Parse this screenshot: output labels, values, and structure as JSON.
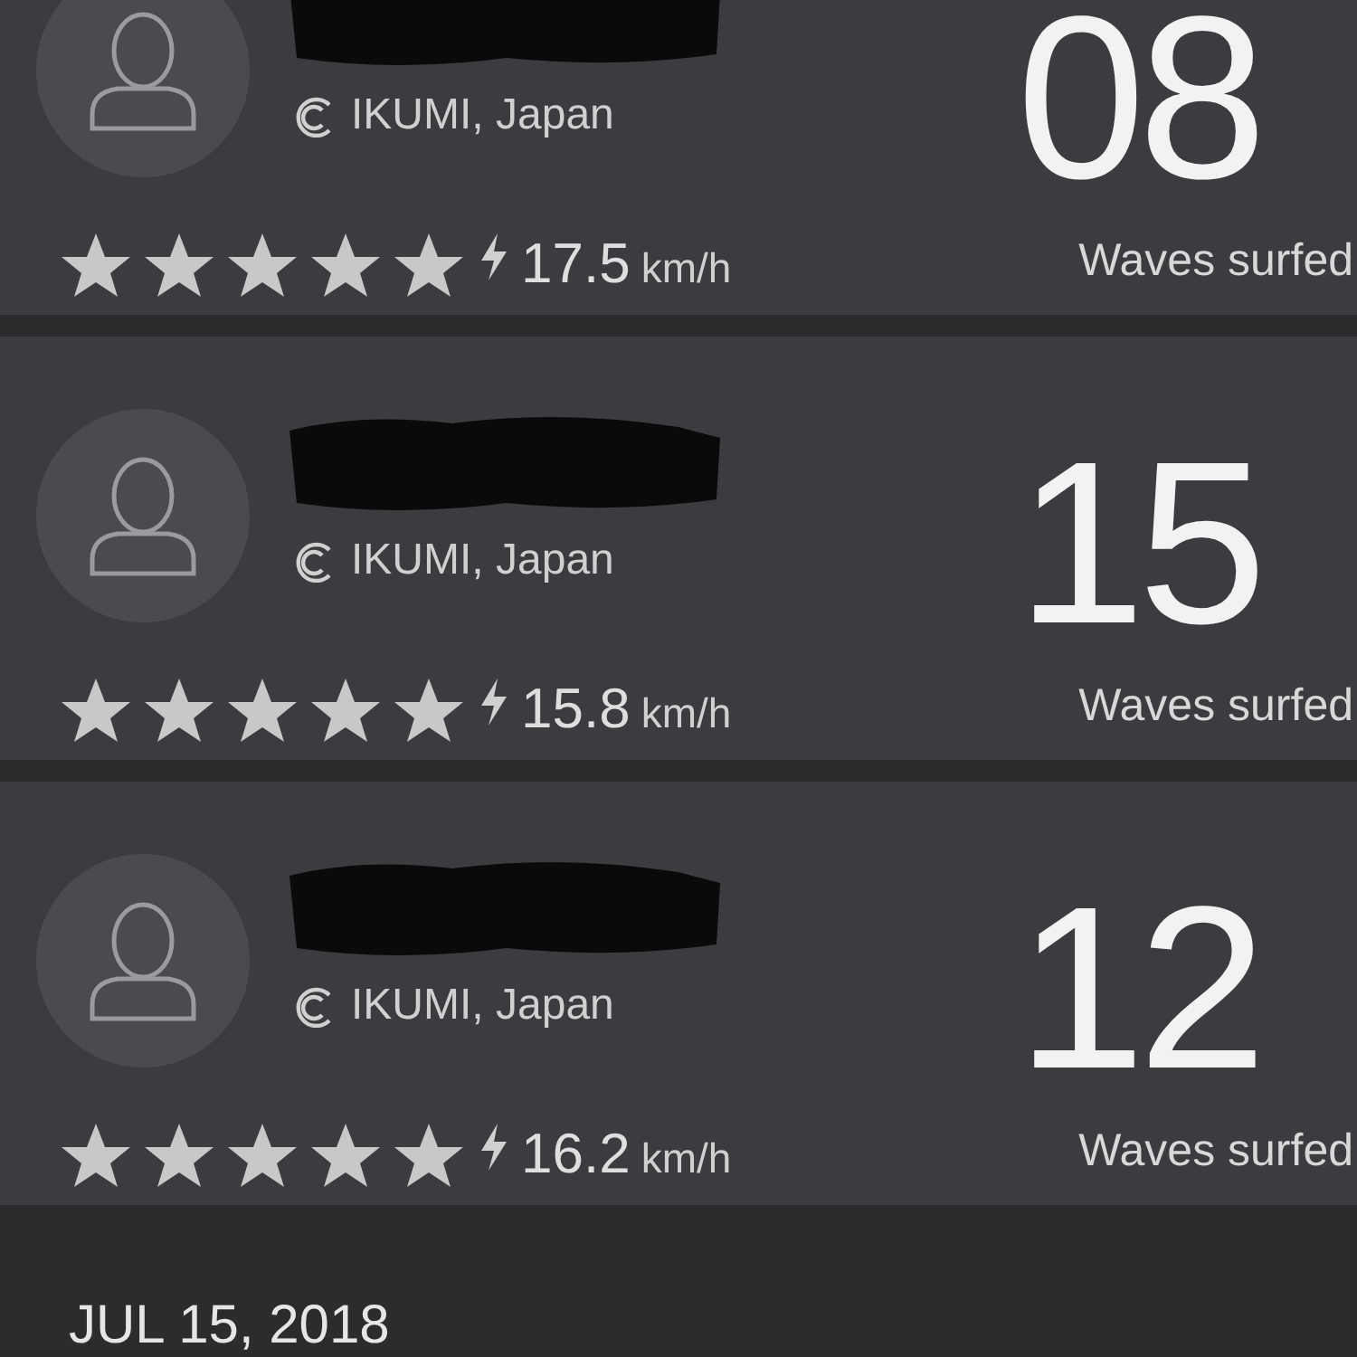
{
  "sessions": [
    {
      "location": "IKUMI, Japan",
      "stars": 5,
      "speed": "17.5",
      "speed_unit": "km/h",
      "waves": "08",
      "waves_label": "Waves surfed"
    },
    {
      "location": "IKUMI, Japan",
      "stars": 5,
      "speed": "15.8",
      "speed_unit": "km/h",
      "waves": "15",
      "waves_label": "Waves surfed"
    },
    {
      "location": "IKUMI, Japan",
      "stars": 5,
      "speed": "16.2",
      "speed_unit": "km/h",
      "waves": "12",
      "waves_label": "Waves surfed"
    }
  ],
  "date_header": "JUL 15, 2018"
}
